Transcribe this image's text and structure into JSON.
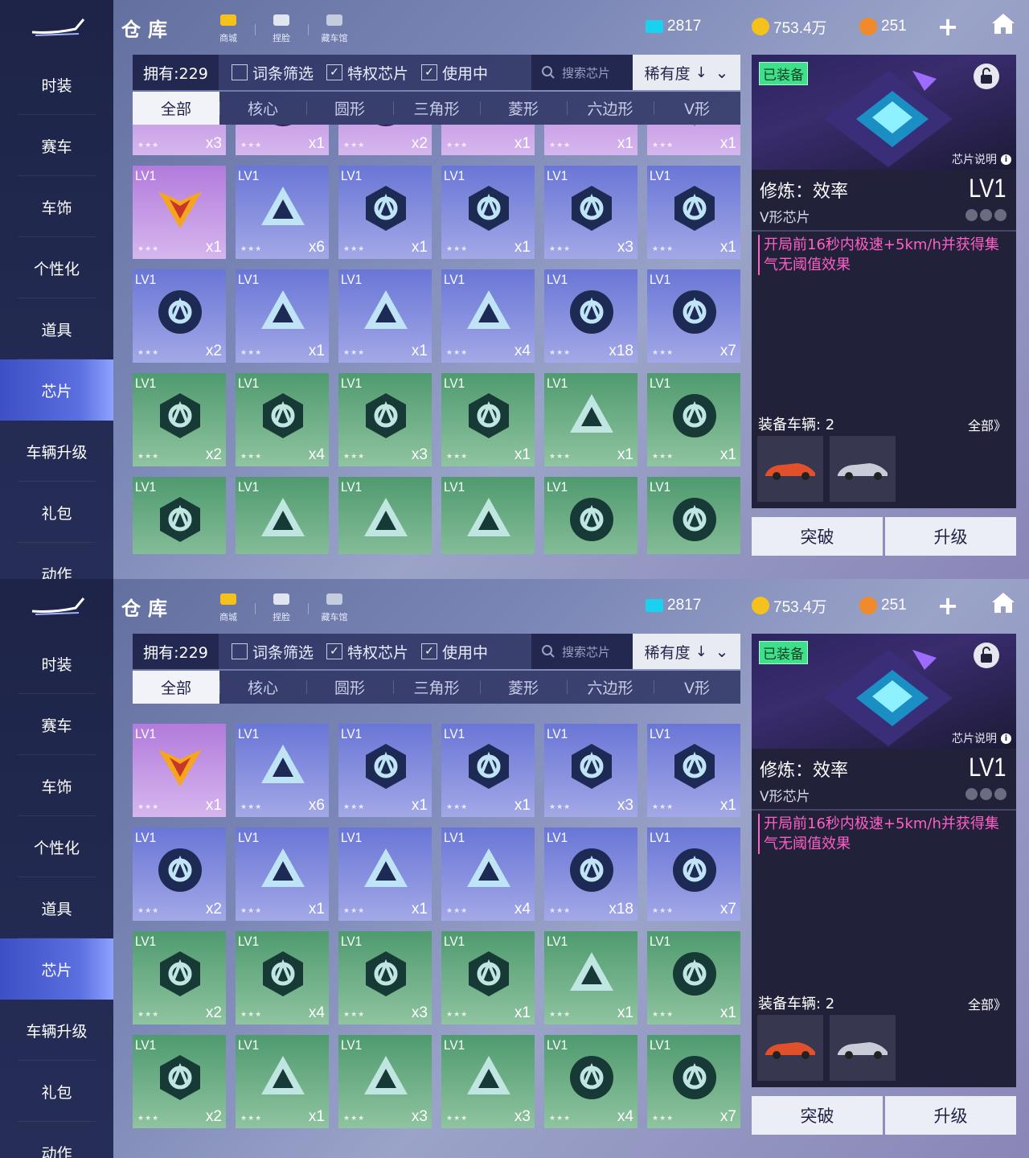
{
  "header": {
    "title": "仓库",
    "shortcuts": [
      {
        "label": "商城",
        "icon": "shop-cart-icon"
      },
      {
        "label": "捏脸",
        "icon": "face-mask-icon"
      },
      {
        "label": "藏车馆",
        "icon": "garage-museum-icon"
      }
    ],
    "currencies": [
      {
        "value": "2817",
        "icon": "ticket-icon",
        "color": "#1ad2f0"
      },
      {
        "value": "753.4万",
        "icon": "gold-coin-icon",
        "color": "#f5c21b"
      },
      {
        "value": "251",
        "icon": "diamond-coin-icon",
        "color": "#f08a2a"
      }
    ],
    "plus_label": "+",
    "plus_icon": "plus-icon",
    "home_icon": "home-icon"
  },
  "sidebar": {
    "items": [
      {
        "label": "时装"
      },
      {
        "label": "赛车"
      },
      {
        "label": "车饰"
      },
      {
        "label": "个性化"
      },
      {
        "label": "道具"
      },
      {
        "label": "芯片",
        "active": true
      },
      {
        "label": "车辆升级"
      },
      {
        "label": "礼包"
      },
      {
        "label": "动作"
      }
    ]
  },
  "filter": {
    "owned": "拥有:229",
    "checks": [
      {
        "label": "词条筛选",
        "checked": false
      },
      {
        "label": "特权芯片",
        "checked": true
      },
      {
        "label": "使用中",
        "checked": true
      }
    ],
    "search_placeholder": "搜索芯片",
    "sort_label": "稀有度",
    "sort_arrow": "↓",
    "sort_chevron": "⌄"
  },
  "tabs": [
    "全部",
    "核心",
    "圆形",
    "三角形",
    "菱形",
    "六边形",
    "V形"
  ],
  "card_level": "LV1",
  "stars": "★★★",
  "grid_top": {
    "rows": [
      [
        {
          "color": "purple",
          "shape": "v",
          "count": "x3",
          "partial": true
        },
        {
          "color": "purple",
          "shape": "circle",
          "count": "x1",
          "partial": true
        },
        {
          "color": "purple",
          "shape": "circle",
          "count": "x2",
          "partial": true
        },
        {
          "color": "purple",
          "shape": "wing",
          "count": "x1",
          "partial": true
        },
        {
          "color": "purple",
          "shape": "wing",
          "count": "x1",
          "partial": true
        },
        {
          "color": "purple",
          "shape": "gem",
          "count": "x1",
          "partial": true
        }
      ],
      [
        {
          "color": "purple",
          "shape": "v",
          "count": "x1"
        },
        {
          "color": "blue",
          "shape": "triangle",
          "count": "x6"
        },
        {
          "color": "blue",
          "shape": "hex",
          "count": "x1"
        },
        {
          "color": "blue",
          "shape": "hex",
          "count": "x1"
        },
        {
          "color": "blue",
          "shape": "hex",
          "count": "x3"
        },
        {
          "color": "blue",
          "shape": "hex",
          "count": "x1"
        }
      ],
      [
        {
          "color": "blue",
          "shape": "circle",
          "count": "x2"
        },
        {
          "color": "blue",
          "shape": "triangle",
          "count": "x1"
        },
        {
          "color": "blue",
          "shape": "triangle",
          "count": "x1"
        },
        {
          "color": "blue",
          "shape": "triangle",
          "count": "x4"
        },
        {
          "color": "blue",
          "shape": "circle",
          "count": "x18"
        },
        {
          "color": "blue",
          "shape": "circle",
          "count": "x7"
        }
      ],
      [
        {
          "color": "green",
          "shape": "hex",
          "count": "x2"
        },
        {
          "color": "green",
          "shape": "hex",
          "count": "x4"
        },
        {
          "color": "green",
          "shape": "hex",
          "count": "x3"
        },
        {
          "color": "green",
          "shape": "hex",
          "count": "x1"
        },
        {
          "color": "green",
          "shape": "triangle",
          "count": "x1"
        },
        {
          "color": "green",
          "shape": "circle",
          "count": "x1"
        }
      ],
      [
        {
          "color": "green",
          "shape": "hex",
          "count": ""
        },
        {
          "color": "green",
          "shape": "triangle",
          "count": ""
        },
        {
          "color": "green",
          "shape": "triangle",
          "count": ""
        },
        {
          "color": "green",
          "shape": "triangle",
          "count": ""
        },
        {
          "color": "green",
          "shape": "circle",
          "count": ""
        },
        {
          "color": "green",
          "shape": "circle",
          "count": ""
        }
      ]
    ]
  },
  "grid_bottom": {
    "rows": [
      [
        {
          "color": "purple",
          "shape": "v",
          "count": "x1"
        },
        {
          "color": "blue",
          "shape": "triangle",
          "count": "x6"
        },
        {
          "color": "blue",
          "shape": "hex",
          "count": "x1"
        },
        {
          "color": "blue",
          "shape": "hex",
          "count": "x1"
        },
        {
          "color": "blue",
          "shape": "hex",
          "count": "x3"
        },
        {
          "color": "blue",
          "shape": "hex",
          "count": "x1"
        }
      ],
      [
        {
          "color": "blue",
          "shape": "circle",
          "count": "x2"
        },
        {
          "color": "blue",
          "shape": "triangle",
          "count": "x1"
        },
        {
          "color": "blue",
          "shape": "triangle",
          "count": "x1"
        },
        {
          "color": "blue",
          "shape": "triangle",
          "count": "x4"
        },
        {
          "color": "blue",
          "shape": "circle",
          "count": "x18"
        },
        {
          "color": "blue",
          "shape": "circle",
          "count": "x7"
        }
      ],
      [
        {
          "color": "green",
          "shape": "hex",
          "count": "x2"
        },
        {
          "color": "green",
          "shape": "hex",
          "count": "x4"
        },
        {
          "color": "green",
          "shape": "hex",
          "count": "x3"
        },
        {
          "color": "green",
          "shape": "hex",
          "count": "x1"
        },
        {
          "color": "green",
          "shape": "triangle",
          "count": "x1"
        },
        {
          "color": "green",
          "shape": "circle",
          "count": "x1"
        }
      ],
      [
        {
          "color": "green",
          "shape": "hex",
          "count": "x2"
        },
        {
          "color": "green",
          "shape": "triangle",
          "count": "x1"
        },
        {
          "color": "green",
          "shape": "triangle",
          "count": "x3"
        },
        {
          "color": "green",
          "shape": "triangle",
          "count": "x3"
        },
        {
          "color": "green",
          "shape": "circle",
          "count": "x4"
        },
        {
          "color": "green",
          "shape": "circle",
          "count": "x7"
        }
      ]
    ]
  },
  "detail": {
    "equipped": "已装备",
    "chip_note": "芯片说明",
    "info_icon_text": "i",
    "name": "修炼：效率",
    "level": "LV1",
    "chip_type": "V形芯片",
    "effect": "开局前16秒内极速+5km/h并获得集气无阈值效果",
    "vehicles_label": "装备车辆: 2",
    "vehicles_all": "全部》",
    "vehicles": [
      {
        "icon": "orange-car-icon",
        "color": "#e0502a"
      },
      {
        "icon": "silver-car-icon",
        "color": "#c8ccd6"
      }
    ]
  },
  "buttons": {
    "breakthrough": "突破",
    "upgrade": "升级"
  }
}
